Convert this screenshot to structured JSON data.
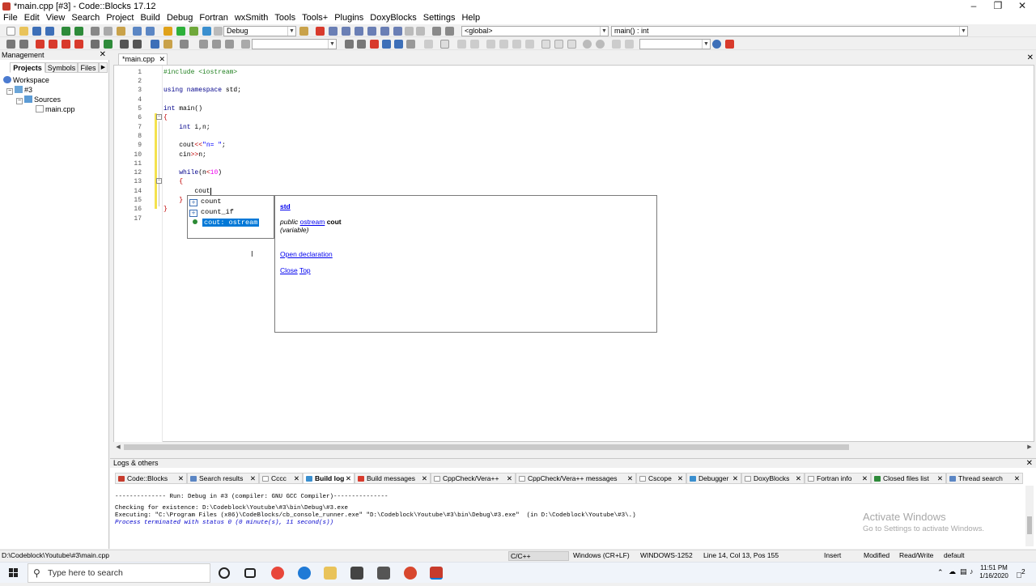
{
  "window": {
    "title": "*main.cpp [#3] - Code::Blocks 17.12"
  },
  "menu": [
    "File",
    "Edit",
    "View",
    "Search",
    "Project",
    "Build",
    "Debug",
    "Fortran",
    "wxSmith",
    "Tools",
    "Tools+",
    "Plugins",
    "DoxyBlocks",
    "Settings",
    "Help"
  ],
  "toolbar": {
    "build_target": "Debug",
    "scope": "<global>",
    "function": "main() : int",
    "search_left": "",
    "search_right": ""
  },
  "management": {
    "title": "Management",
    "tabs": [
      "Projects",
      "Symbols",
      "Files"
    ],
    "tree": {
      "workspace": "Workspace",
      "project": "#3",
      "folder": "Sources",
      "file": "main.cpp"
    }
  },
  "editor": {
    "tab": "*main.cpp",
    "line_numbers": [
      "1",
      "2",
      "3",
      "4",
      "5",
      "6",
      "7",
      "8",
      "9",
      "10",
      "11",
      "12",
      "13",
      "14",
      "15",
      "16",
      "17"
    ],
    "code": {
      "l1": "#include <iostream>",
      "l3_a": "using namespace",
      "l3_b": " std;",
      "l5_a": "int",
      "l5_b": " main()",
      "l6": "{",
      "l7_a": "    int",
      "l7_b": " i,n;",
      "l9_a": "    cout",
      "l9_b": "<<",
      "l9_c": "\"n= \"",
      "l9_d": ";",
      "l10_a": "    cin",
      "l10_b": ">>",
      "l10_c": "n;",
      "l12_a": "    while",
      "l12_b": "(n",
      "l12_c": "<",
      "l12_d": "10",
      "l12_e": ")",
      "l13": "    {",
      "l14": "        cout",
      "l15": "    }",
      "l16": "}"
    }
  },
  "autocomplete": {
    "items": [
      "count",
      "count_if",
      "cout: ostream"
    ],
    "doc": {
      "namespace": "std",
      "sig_public": "public",
      "sig_type": "ostream",
      "sig_name": "cout",
      "kind": "(variable)",
      "open_declaration": "Open declaration",
      "close": "Close",
      "top": "Top"
    }
  },
  "logs": {
    "title": "Logs & others",
    "tabs": [
      "Code::Blocks",
      "Search results",
      "Cccc",
      "Build log",
      "Build messages",
      "CppCheck/Vera++",
      "CppCheck/Vera++ messages",
      "Cscope",
      "Debugger",
      "DoxyBlocks",
      "Fortran info",
      "Closed files list",
      "Thread search"
    ],
    "active_tab": "Build log",
    "lines": [
      "-------------- Run: Debug in #3 (compiler: GNU GCC Compiler)---------------",
      "Checking for existence: D:\\Codeblock\\Youtube\\#3\\bin\\Debug\\#3.exe",
      "Executing: \"C:\\Program Files (x86)\\CodeBlocks/cb_console_runner.exe\" \"D:\\Codeblock\\Youtube\\#3\\bin\\Debug\\#3.exe\"  (in D:\\Codeblock\\Youtube\\#3\\.)",
      "Process terminated with status 0 (0 minute(s), 11 second(s))"
    ]
  },
  "watermark": {
    "title": "Activate Windows",
    "subtitle": "Go to Settings to activate Windows."
  },
  "status": {
    "path": "D:\\Codeblock\\Youtube\\#3\\main.cpp",
    "language": "C/C++",
    "eol": "Windows (CR+LF)",
    "encoding": "WINDOWS-1252",
    "position": "Line 14, Col 13, Pos 155",
    "mode": "Insert",
    "modified": "Modified",
    "rw": "Read/Write",
    "profile": "default"
  },
  "taskbar": {
    "search_placeholder": "Type here to search",
    "time": "11:51 PM",
    "date": "1/16/2020",
    "notifications": "2"
  },
  "colors": {
    "accent": "#0078d7",
    "keyword": "#00008b",
    "preprocessor": "#1e7f1e",
    "string": "#0000ff",
    "operator": "#c00000",
    "number": "#ee00ee"
  }
}
